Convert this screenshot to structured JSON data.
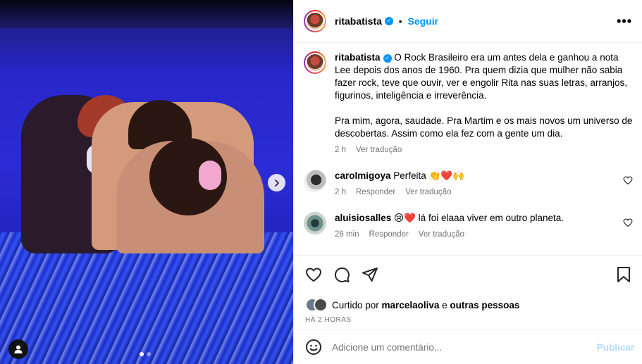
{
  "post": {
    "author": "ritabatista",
    "follow_label": "Seguir",
    "dot_separator": "•",
    "more_label": "•••"
  },
  "caption": {
    "username": "ritabatista",
    "text_p1": " O Rock Brasileiro era um antes dela e ganhou a nota Lee depois dos anos de 1960. Pra quem dizia que mulher não sabia fazer rock, teve que ouvir, ver e engolir Rita nas suas letras, arranjos, figurinos, inteligência e irreverência.",
    "text_p2": "Pra mim, agora, saudade. Pra Martim e os mais novos um universo de descobertas. Assim como ela fez com a gente um dia.",
    "time": "2 h",
    "translate": "Ver tradução"
  },
  "comments": [
    {
      "username": "carolmigoya",
      "text": " Perfeita 👏❤️🙌",
      "time": "2 h",
      "reply": "Responder",
      "translate": "Ver tradução"
    },
    {
      "username": "aluisiosalles",
      "text": " 😢❤️ lá foi elaaa viver em outro planeta.",
      "time": "26 min",
      "reply": "Responder",
      "translate": "Ver tradução"
    }
  ],
  "likes": {
    "prefix": "Curtido por ",
    "user": "marcelaoliva",
    "middle": " e ",
    "others": "outras pessoas"
  },
  "time_ago": "HÁ 2 HORAS",
  "add_comment": {
    "placeholder": "Adicione um comentário...",
    "publish": "Publicar"
  },
  "carousel": {
    "total": 2,
    "active": 1
  },
  "colors": {
    "accent": "#0095f6",
    "publish_disabled": "#b3dbff",
    "muted": "#737373"
  },
  "icons": [
    "chevron-right-icon",
    "user-tag-icon",
    "heart-icon",
    "comment-icon",
    "share-icon",
    "bookmark-icon",
    "emoji-icon",
    "verified-icon"
  ]
}
